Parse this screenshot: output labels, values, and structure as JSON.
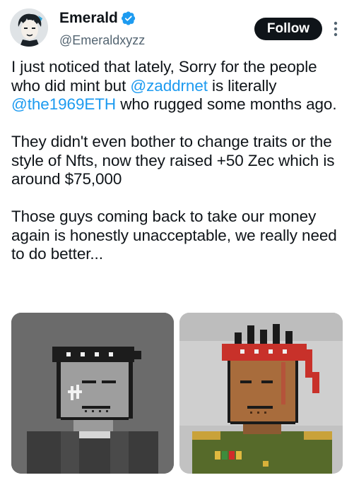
{
  "author": {
    "display_name": "Emerald",
    "handle": "@Emeraldxyzz",
    "verified_icon": "verified-badge-icon",
    "avatar_icon": "avatar-image"
  },
  "actions": {
    "follow_label": "Follow",
    "more_icon": "more-options-icon"
  },
  "tweet": {
    "p1_a": "I just noticed that lately, Sorry for the people who did mint but ",
    "mention1": "@zaddrnet",
    "p1_b": " is literally ",
    "mention2": "@the1969ETH",
    "p1_c": " who rugged some months ago.",
    "p2": "They didn't even bother to change traits or the style of Nfts, now they raised +50 Zec which is around $75,000",
    "p3": "Those guys coming back to take our money again is honestly unacceptable, we really need to do better..."
  },
  "media": [
    {
      "name": "nft-image-grayscale",
      "background": "#6a6a6a"
    },
    {
      "name": "nft-image-soldier",
      "background": "#d4d4d4"
    }
  ],
  "colors": {
    "mention": "#1d9bf0",
    "text": "#0f1419",
    "secondary_text": "#536471",
    "verified": "#1d9bf0"
  }
}
